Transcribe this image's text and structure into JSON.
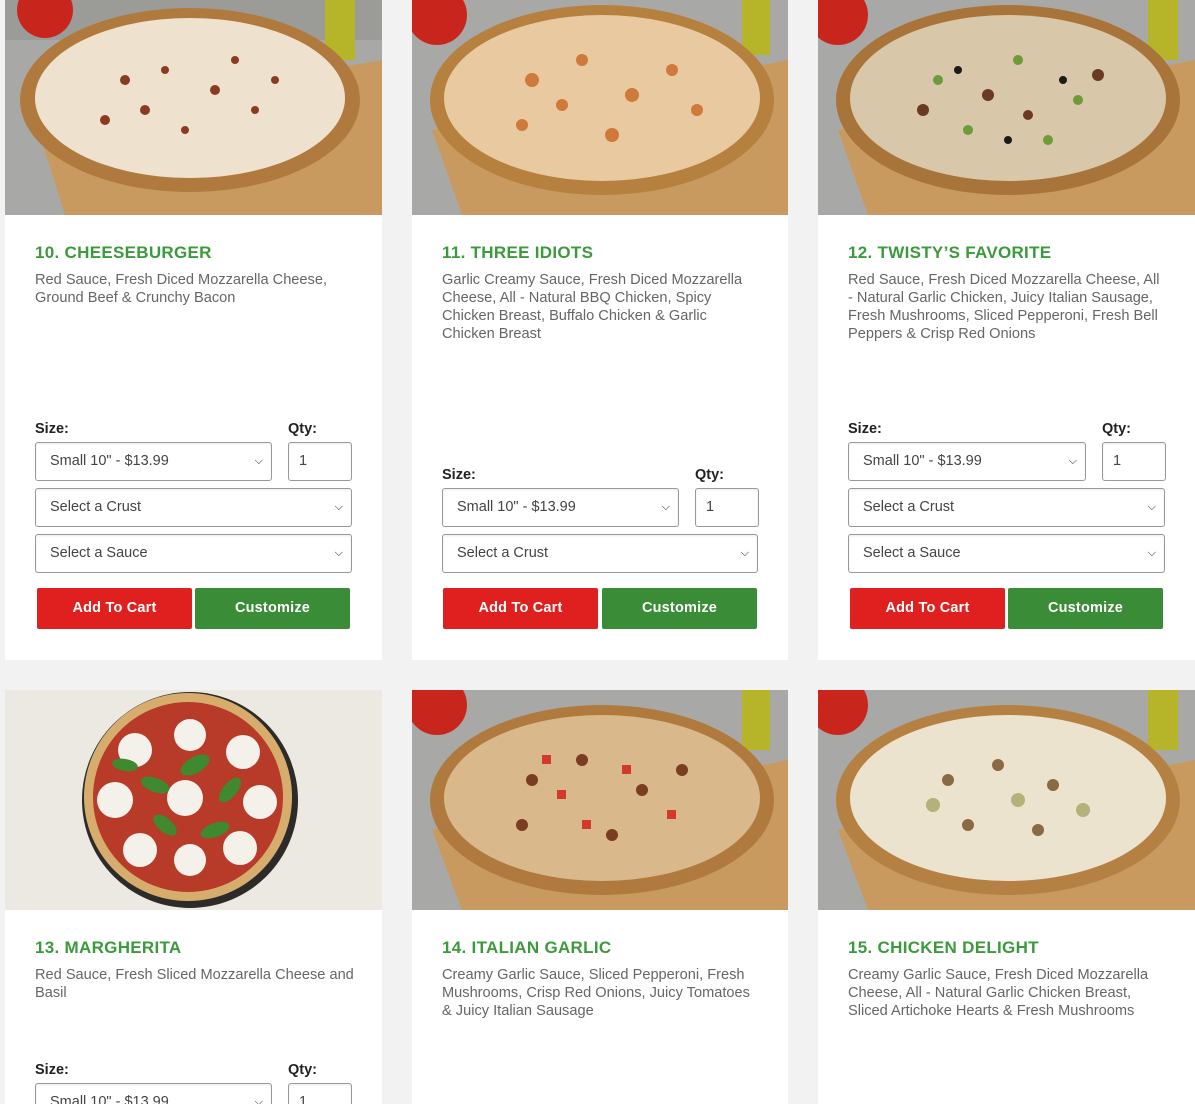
{
  "labels": {
    "size": "Size:",
    "qty": "Qty:",
    "add_to_cart": "Add To Cart",
    "customize": "Customize"
  },
  "colors": {
    "title_green": "#3b9a3b",
    "add_to_cart_red": "#e0201f",
    "customize_green": "#3a8c37"
  },
  "products": [
    {
      "title": "10. CHEESEBURGER",
      "description": "Red Sauce, Fresh Diced Mozzarella Cheese, Ground Beef & Crunchy Bacon",
      "size_selected": "Small 10\" - $13.99",
      "qty": "1",
      "crust": "Select a Crust",
      "sauce": "Select a Sauce"
    },
    {
      "title": "11. THREE IDIOTS",
      "description": "Garlic Creamy Sauce, Fresh Diced Mozzarella Cheese, All - Natural BBQ Chicken, Spicy Chicken Breast, Buffalo Chicken & Garlic Chicken Breast",
      "size_selected": "Small 10\" - $13.99",
      "qty": "1",
      "crust": "Select a Crust"
    },
    {
      "title": "12. TWISTY’S FAVORITE",
      "description": "Red Sauce, Fresh Diced Mozzarella Cheese, All - Natural Garlic Chicken, Juicy Italian Sausage, Fresh Mushrooms, Sliced Pepperoni, Fresh Bell Peppers & Crisp Red Onions",
      "size_selected": "Small 10\" - $13.99",
      "qty": "1",
      "crust": "Select a Crust",
      "sauce": "Select a Sauce"
    },
    {
      "title": "13. MARGHERITA",
      "description": "Red Sauce, Fresh Sliced Mozzarella Cheese and Basil",
      "size_selected": "Small 10\" - $13.99",
      "qty": "1"
    },
    {
      "title": "14. ITALIAN GARLIC",
      "description": "Creamy Garlic Sauce, Sliced Pepperoni, Fresh Mushrooms, Crisp Red Onions, Juicy Tomatoes & Juicy Italian Sausage"
    },
    {
      "title": "15. CHICKEN DELIGHT",
      "description": "Creamy Garlic Sauce, Fresh Diced Mozzarella Cheese, All - Natural Garlic Chicken Breast, Sliced Artichoke Hearts & Fresh Mushrooms"
    }
  ]
}
